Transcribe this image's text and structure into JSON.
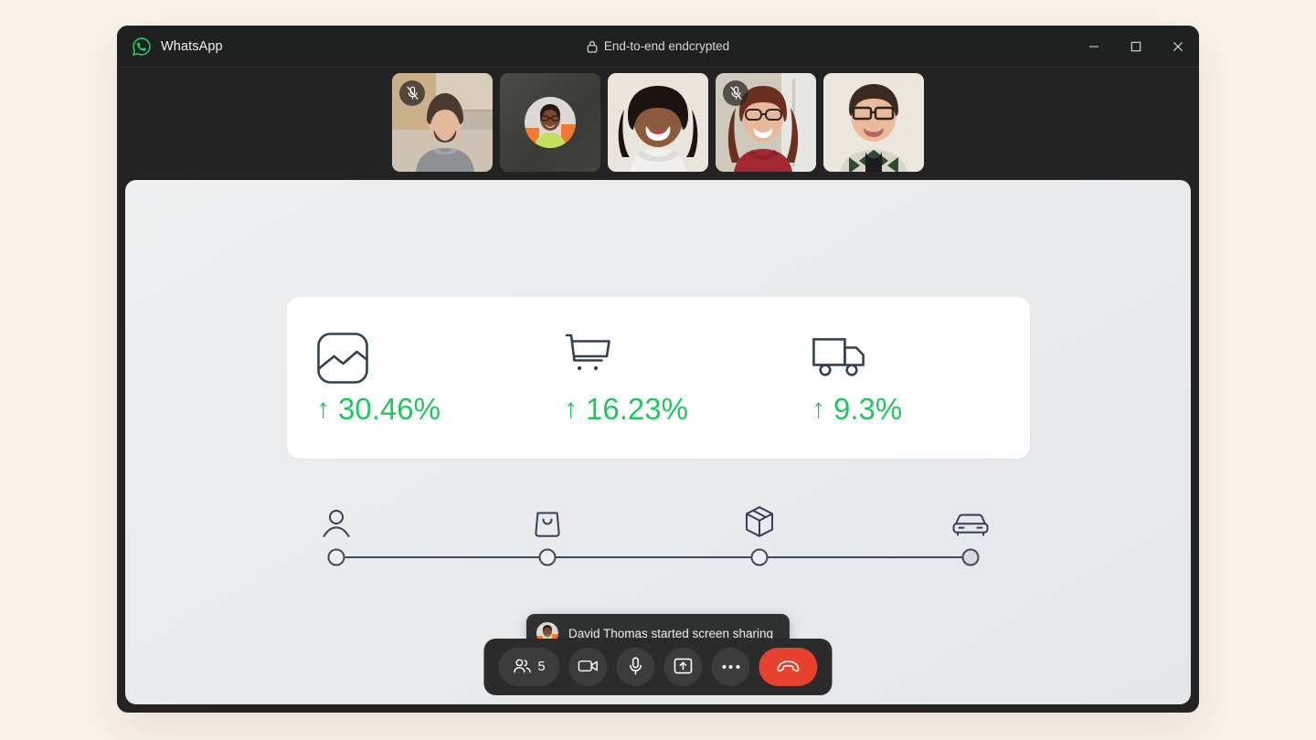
{
  "window": {
    "brand_name": "WhatsApp",
    "encryption_label": "End-to-end endcrypted",
    "encryption_icon": "lock-icon",
    "logo_icon": "whatsapp-logo-icon",
    "controls": {
      "minimize": "minimize-icon",
      "maximize": "maximize-icon",
      "close": "close-icon"
    },
    "background_color": "#232323",
    "titlebar_color": "#1f2020"
  },
  "page": {
    "background_color": "#faf3ea"
  },
  "participants": [
    {
      "name": "participant-1",
      "camera_on": true,
      "muted": true,
      "badge_icon": "mic-off-icon"
    },
    {
      "name": "David Thomas",
      "camera_on": false,
      "muted": false,
      "badge_icon": ""
    },
    {
      "name": "participant-3",
      "camera_on": true,
      "muted": false,
      "badge_icon": ""
    },
    {
      "name": "participant-4",
      "camera_on": true,
      "muted": true,
      "badge_icon": "mic-off-icon"
    },
    {
      "name": "participant-5",
      "camera_on": true,
      "muted": false,
      "badge_icon": ""
    }
  ],
  "shared_screen": {
    "metrics": [
      {
        "icon": "image-chart-icon",
        "arrow": "↑",
        "value": "30.46%",
        "direction": "up"
      },
      {
        "icon": "shopping-cart-icon",
        "arrow": "↑",
        "value": "16.23%",
        "direction": "up"
      },
      {
        "icon": "delivery-truck-icon",
        "arrow": "↑",
        "value": "9.3%",
        "direction": "up"
      }
    ],
    "metric_positive_color": "#22c55e",
    "metric_icon_color": "#344054",
    "funnel_steps": [
      {
        "icon": "person-icon",
        "state": "open"
      },
      {
        "icon": "shopping-bag-icon",
        "state": "open"
      },
      {
        "icon": "package-box-icon",
        "state": "open"
      },
      {
        "icon": "car-icon",
        "state": "done"
      }
    ]
  },
  "toast": {
    "avatar_icon": "user-avatar",
    "message": "David Thomas started screen sharing"
  },
  "call_controls": {
    "participants_count": "5",
    "participants_icon": "people-icon",
    "camera_icon": "video-camera-icon",
    "mic_icon": "microphone-icon",
    "share_icon": "share-screen-icon",
    "more_icon": "more-options-icon",
    "hangup_icon": "end-call-icon",
    "hangup_color": "#e8422e"
  }
}
